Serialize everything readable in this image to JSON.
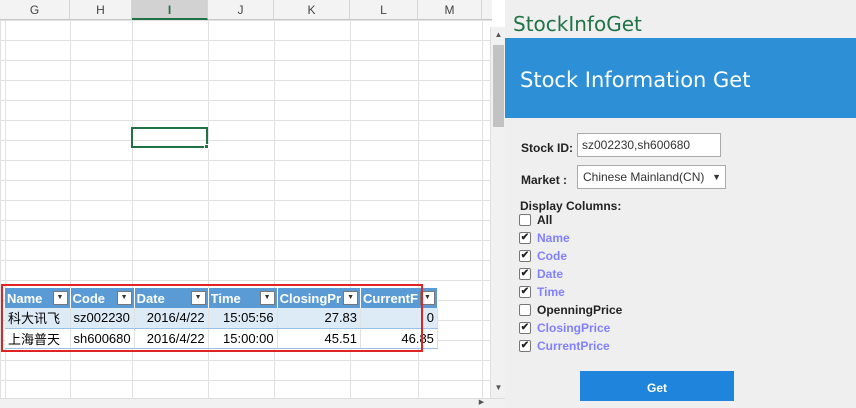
{
  "spreadsheet": {
    "columns": [
      "G",
      "H",
      "I",
      "J",
      "K",
      "L",
      "M"
    ],
    "selected_column": "I",
    "table": {
      "headers": [
        "Name",
        "Code",
        "Date",
        "Time",
        "ClosingPr",
        "CurrentF"
      ],
      "rows": [
        [
          "科大讯飞",
          "sz002230",
          "2016/4/22",
          "15:05:56",
          "27.83",
          "0"
        ],
        [
          "上海普天",
          "sh600680",
          "2016/4/22",
          "15:00:00",
          "45.51",
          "46.85"
        ]
      ]
    },
    "accent_color": "#217346",
    "table_header_color": "#5b9bd5",
    "highlight_outline_color": "#e02424"
  },
  "pane": {
    "app_title": "StockInfoGet",
    "banner_title": "Stock Information Get",
    "banner_color": "#2d8fd6",
    "stock_id_label": "Stock ID:",
    "stock_id_value": "sz002230,sh600680",
    "market_label": "Market :",
    "market_value": "Chinese Mainland(CN)",
    "display_columns_label": "Display Columns:",
    "columns": [
      {
        "label": "All",
        "checked": false
      },
      {
        "label": "Name",
        "checked": true
      },
      {
        "label": "Code",
        "checked": true
      },
      {
        "label": "Date",
        "checked": true
      },
      {
        "label": "Time",
        "checked": true
      },
      {
        "label": "OpenningPrice",
        "checked": false
      },
      {
        "label": "ClosingPrice",
        "checked": true
      },
      {
        "label": "CurrentPrice",
        "checked": true
      }
    ],
    "get_button_label": "Get",
    "button_color": "#1f84dc"
  }
}
